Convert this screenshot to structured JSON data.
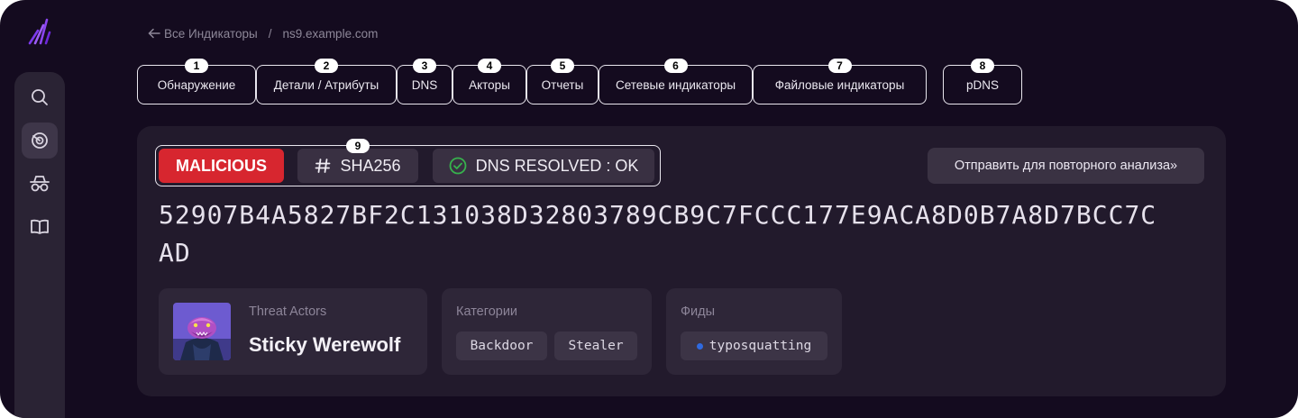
{
  "breadcrumb": {
    "back": "Все Индикаторы",
    "separator": "/",
    "current": "ns9.example.com"
  },
  "tabs": [
    {
      "num": "1",
      "label": "Обнаружение"
    },
    {
      "num": "2",
      "label": "Детали / Атрибуты"
    },
    {
      "num": "3",
      "label": "DNS"
    },
    {
      "num": "4",
      "label": "Акторы"
    },
    {
      "num": "5",
      "label": "Отчеты"
    },
    {
      "num": "6",
      "label": "Сетевые индикаторы"
    },
    {
      "num": "7",
      "label": "Файловые индикаторы"
    },
    {
      "num": "8",
      "label": "pDNS"
    }
  ],
  "sidebar": {
    "items": [
      "search-icon",
      "radar-icon",
      "spy-icon",
      "book-icon"
    ],
    "active": "radar-icon"
  },
  "tags": {
    "verdict": "MALICIOUS",
    "hash_type": "SHA256",
    "hash_badge": "9",
    "dns_status": "DNS RESOLVED : OK"
  },
  "actions": {
    "reanalyze": "Отправить для повторного анализа»"
  },
  "indicator": {
    "hash": "52907B4A5827BF2C131038D32803789CB9C7FCCC177E9ACA8D0B7A8D7BCC7CAD"
  },
  "threat_actors": {
    "label": "Threat Actors",
    "name": "Sticky Werewolf"
  },
  "categories": {
    "label": "Категории",
    "items": [
      "Backdoor",
      "Stealer"
    ]
  },
  "feeds": {
    "label": "Фиды",
    "items": [
      "typosquatting"
    ]
  },
  "colors": {
    "background": "#140b1f",
    "panel": "#221a2c",
    "card": "#2e2638",
    "malicious": "#d7262f",
    "ok": "#37b24d",
    "feed_dot": "#2f6ae0",
    "brand": "#7c3aed"
  }
}
